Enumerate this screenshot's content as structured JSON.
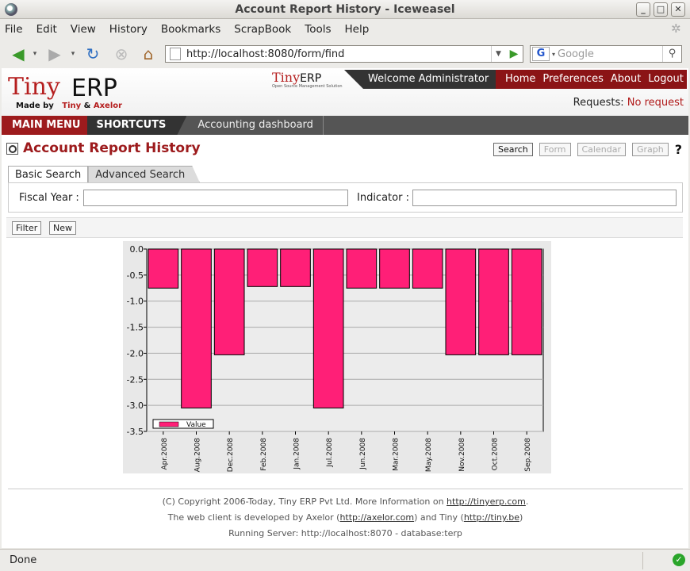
{
  "window": {
    "title": "Account Report History - Iceweasel"
  },
  "menubar": {
    "items": [
      "File",
      "Edit",
      "View",
      "History",
      "Bookmarks",
      "ScrapBook",
      "Tools",
      "Help"
    ]
  },
  "navbar": {
    "url": "http://localhost:8080/form/find",
    "search_placeholder": "Google"
  },
  "header": {
    "logo": {
      "tiny": "Tiny",
      "erp": "ERP",
      "made_by": "Made by",
      "made_tiny": "Tiny",
      "made_and": "&",
      "made_axelor": "Axelor"
    },
    "mini_logo": {
      "tiny": "Tiny",
      "erp": "ERP",
      "tagline": "Open Source Management Solution"
    },
    "welcome": "Welcome Administrator",
    "links": [
      "Home",
      "Preferences",
      "About",
      "Logout"
    ],
    "requests_label": "Requests:",
    "requests_value": "No request"
  },
  "mainnav": {
    "main_menu": "MAIN MENU",
    "shortcuts": "SHORTCUTS",
    "dashboard": "Accounting dashboard"
  },
  "page": {
    "title": "Account Report History",
    "view_buttons": [
      "Search",
      "Form",
      "Calendar",
      "Graph"
    ],
    "help": "?"
  },
  "search": {
    "tabs": [
      "Basic Search",
      "Advanced Search"
    ],
    "fiscal_year_label": "Fiscal Year :",
    "indicator_label": "Indicator :",
    "fiscal_year_value": "",
    "indicator_value": ""
  },
  "actions": {
    "filter": "Filter",
    "new": "New"
  },
  "chart_data": {
    "type": "bar",
    "categories": [
      "Apr.2008",
      "Aug.2008",
      "Dec.2008",
      "Feb.2008",
      "Jan.2008",
      "Jul.2008",
      "Jun.2008",
      "Mar.2008",
      "May.2008",
      "Nov.2008",
      "Oct.2008",
      "Sep.2008"
    ],
    "series": [
      {
        "name": "Value",
        "values": [
          -0.75,
          -3.05,
          -2.03,
          -0.72,
          -0.72,
          -3.05,
          -0.75,
          -0.75,
          -0.75,
          -2.03,
          -2.03,
          -2.03
        ]
      }
    ],
    "ylim": [
      -3.5,
      0.0
    ],
    "yticks": [
      "0.0",
      "-0.5",
      "-1.0",
      "-1.5",
      "-2.0",
      "-2.5",
      "-3.0",
      "-3.5"
    ],
    "bar_color": "#ff1f77",
    "legend": "bottom-left",
    "grid": true
  },
  "footer": {
    "line1_prefix": "(C) Copyright 2006-Today, Tiny ERP Pvt Ltd. More Information on ",
    "line1_link": "http://tinyerp.com",
    "line1_suffix": ".",
    "line2_prefix": "The web client is developed by Axelor (",
    "line2_link1": "http://axelor.com",
    "line2_mid": ") and Tiny (",
    "line2_link2": "http://tiny.be",
    "line2_suffix": ")",
    "line3": "Running Server: http://localhost:8070 - database:terp"
  },
  "status": {
    "text": "Done"
  }
}
